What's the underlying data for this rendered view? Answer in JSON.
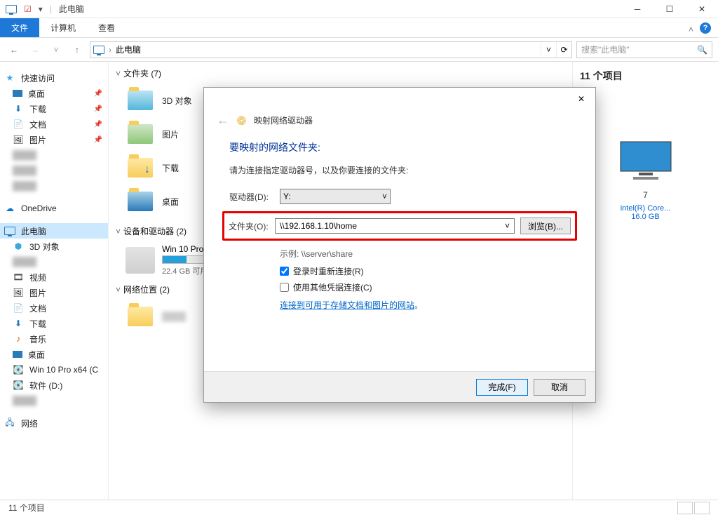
{
  "titlebar": {
    "title": "此电脑"
  },
  "ribbon": {
    "file": "文件",
    "tab_computer": "计算机",
    "tab_view": "查看"
  },
  "address": {
    "location": "此电脑",
    "search_placeholder": "搜索\"此电脑\""
  },
  "sidebar": {
    "quick_access": "快速访问",
    "desktop": "桌面",
    "downloads": "下载",
    "documents": "文档",
    "pictures": "图片",
    "onedrive": "OneDrive",
    "this_pc": "此电脑",
    "obj3d": "3D 对象",
    "videos": "视频",
    "music": "音乐",
    "win10": "Win 10 Pro x64 (C",
    "software": "软件 (D:)",
    "network": "网络"
  },
  "content": {
    "folders_head": "文件夹 (7)",
    "f_3d": "3D 对象",
    "f_pictures": "图片",
    "f_downloads": "下载",
    "f_desktop": "桌面",
    "devices_head": "设备和驱动器 (2)",
    "drive_c_name": "Win 10 Pro x",
    "drive_c_sub": "22.4 GB 可用",
    "netloc_head": "网络位置 (2)"
  },
  "right": {
    "count": "11 个项目",
    "model_suffix": "7",
    "cpu": "intel(R) Core...",
    "ram": "16.0 GB"
  },
  "status": {
    "items": "11 个项目"
  },
  "dialog": {
    "header": "映射网络驱动器",
    "title": "要映射的网络文件夹:",
    "subtitle": "请为连接指定驱动器号，以及你要连接的文件夹:",
    "drive_label": "驱动器(D):",
    "drive_value": "Y:",
    "folder_label": "文件夹(O):",
    "folder_value": "\\\\192.168.1.10\\home",
    "browse": "浏览(B)...",
    "example": "示例: \\\\server\\share",
    "reconnect": "登录时重新连接(R)",
    "other_cred": "使用其他凭据连接(C)",
    "link": "连接到可用于存储文档和图片的网站",
    "link_dot": "。",
    "finish": "完成(F)",
    "cancel": "取消"
  }
}
